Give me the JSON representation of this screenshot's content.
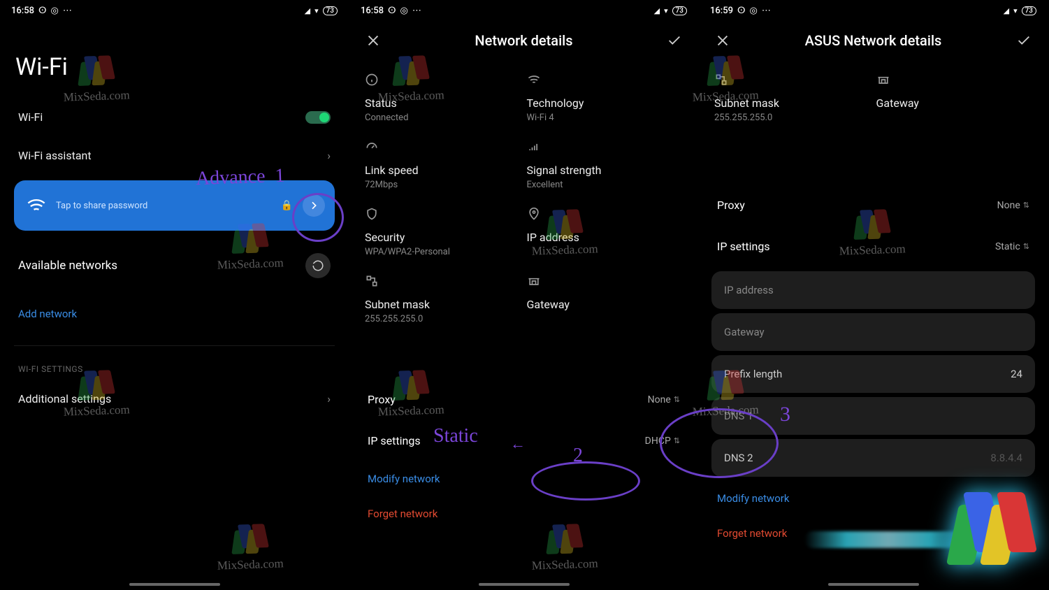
{
  "watermark_text": "MixSeda.com",
  "status": {
    "time1": "16:58",
    "time2": "16:58",
    "time3": "16:59",
    "battery": "73"
  },
  "annotations": {
    "a1_text": "Advance",
    "a1_num": "1",
    "a2_text": "Static",
    "a2_num": "2",
    "a3_num": "3"
  },
  "screen1": {
    "title": "Wi-Fi",
    "wifi_label": "Wi-Fi",
    "assistant_label": "Wi-Fi assistant",
    "share_text": "Tap to share password",
    "available_label": "Available networks",
    "add_network": "Add network",
    "section_label": "WI-FI SETTINGS",
    "additional_label": "Additional settings"
  },
  "screen2": {
    "title": "Network details",
    "status_label": "Status",
    "status_value": "Connected",
    "tech_label": "Technology",
    "tech_value": "Wi-Fi 4",
    "linkspeed_label": "Link speed",
    "linkspeed_value": "72Mbps",
    "signal_label": "Signal strength",
    "signal_value": "Excellent",
    "security_label": "Security",
    "security_value": "WPA/WPA2-Personal",
    "ip_label": "IP address",
    "subnet_label": "Subnet mask",
    "subnet_value": "255.255.255.0",
    "gateway_label": "Gateway",
    "proxy_label": "Proxy",
    "proxy_value": "None",
    "ipset_label": "IP settings",
    "ipset_value": "DHCP",
    "modify": "Modify network",
    "forget": "Forget network"
  },
  "screen3": {
    "title": "ASUS Network details",
    "subnet_label": "Subnet mask",
    "subnet_value": "255.255.255.0",
    "gateway_label": "Gateway",
    "proxy_label": "Proxy",
    "proxy_value": "None",
    "ipset_label": "IP settings",
    "ipset_value": "Static",
    "ip_field": "IP address",
    "gateway_field": "Gateway",
    "prefix_field": "Prefix length",
    "prefix_value": "24",
    "dns1_field": "DNS 1",
    "dns2_field": "DNS 2",
    "dns2_value": "8.8.4.4",
    "modify": "Modify network",
    "forget": "Forget network"
  }
}
